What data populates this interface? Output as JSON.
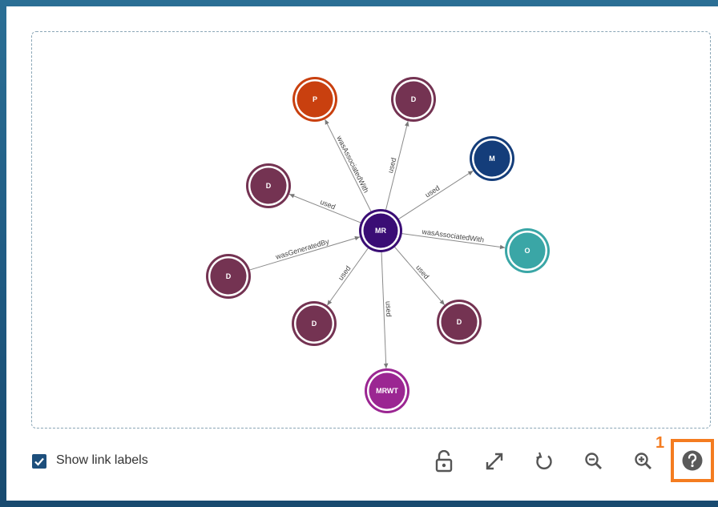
{
  "graph": {
    "center": {
      "id": "center",
      "label": "MR",
      "color": "#3a0d75"
    },
    "nodes": [
      {
        "id": "p",
        "label": "P",
        "color": "#c9400f"
      },
      {
        "id": "d-top",
        "label": "D",
        "color": "#743352"
      },
      {
        "id": "m",
        "label": "M",
        "color": "#143d7a"
      },
      {
        "id": "o",
        "label": "O",
        "color": "#3aa6a6"
      },
      {
        "id": "d-br",
        "label": "D",
        "color": "#743352"
      },
      {
        "id": "mrwt",
        "label": "MRWT",
        "color": "#9b2692"
      },
      {
        "id": "d-bl",
        "label": "D",
        "color": "#743352"
      },
      {
        "id": "d-l",
        "label": "D",
        "color": "#743352"
      },
      {
        "id": "d-ul",
        "label": "D",
        "color": "#743352"
      }
    ],
    "edges": [
      {
        "to": "p",
        "label": "wasAssociatedWith",
        "dir": "out"
      },
      {
        "to": "d-top",
        "label": "used",
        "dir": "out"
      },
      {
        "to": "m",
        "label": "used",
        "dir": "out"
      },
      {
        "to": "o",
        "label": "wasAssociatedWith",
        "dir": "out"
      },
      {
        "to": "d-br",
        "label": "used",
        "dir": "out"
      },
      {
        "to": "mrwt",
        "label": "used",
        "dir": "out"
      },
      {
        "to": "d-bl",
        "label": "used",
        "dir": "out"
      },
      {
        "to": "d-l",
        "label": "wasGeneratedBy",
        "dir": "in"
      },
      {
        "to": "d-ul",
        "label": "used",
        "dir": "out"
      }
    ]
  },
  "controls": {
    "show_link_labels": "Show link labels",
    "show_link_labels_checked": true,
    "tools": [
      "lock-open-icon",
      "expand-icon",
      "reset-icon",
      "zoom-out-icon",
      "zoom-in-icon",
      "help-icon"
    ],
    "help_marker": "1",
    "highlight_color": "#f47c20"
  }
}
